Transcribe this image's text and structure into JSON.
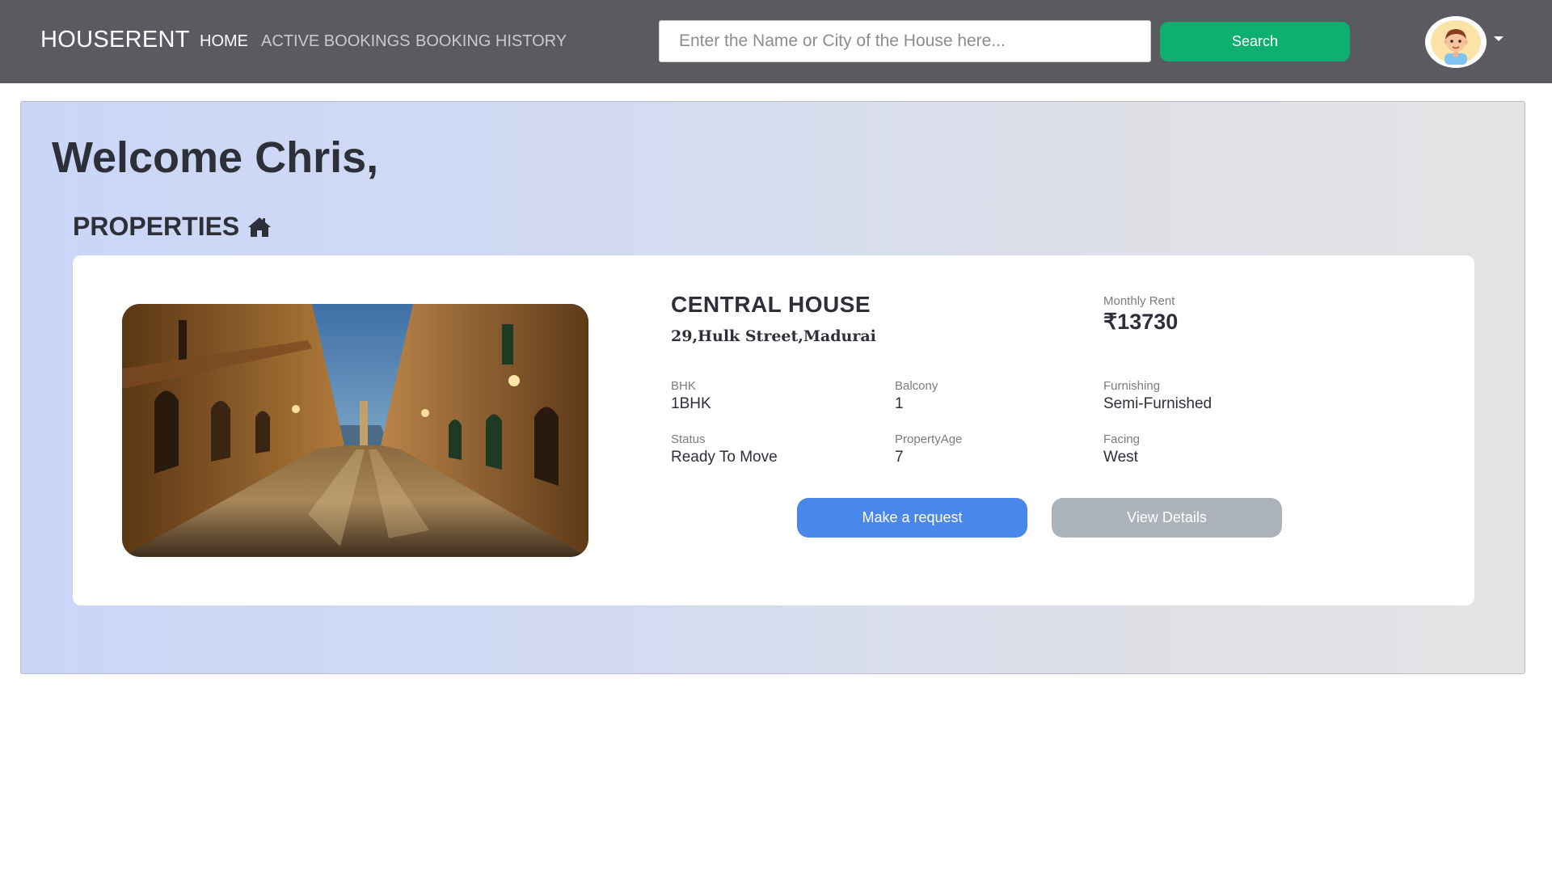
{
  "navbar": {
    "brand": "HOUSERENT",
    "links": [
      {
        "label": "HOME",
        "active": true
      },
      {
        "label": "ACTIVE BOOKINGS",
        "active": false
      },
      {
        "label": "BOOKING HISTORY",
        "active": false
      }
    ],
    "search": {
      "placeholder": "Enter the Name or City of the House here...",
      "value": "",
      "button_label": "Search"
    },
    "avatar_icon": "user-avatar-icon",
    "dropdown_icon": "caret-down-icon"
  },
  "main": {
    "welcome": "Welcome Chris,",
    "section_title": "PROPERTIES",
    "section_icon": "home-icon"
  },
  "property": {
    "name": "CENTRAL HOUSE",
    "address": "29,Hulk Street,Madurai",
    "rent_label": "Monthly Rent",
    "rent_value": "₹13730",
    "attributes": [
      {
        "label": "BHK",
        "value": "1BHK"
      },
      {
        "label": "Balcony",
        "value": "1"
      },
      {
        "label": "Furnishing",
        "value": "Semi-Furnished"
      },
      {
        "label": "Status",
        "value": "Ready To Move"
      },
      {
        "label": "PropertyAge",
        "value": "7"
      },
      {
        "label": "Facing",
        "value": "West"
      }
    ],
    "request_button": "Make a request",
    "details_button": "View Details"
  },
  "colors": {
    "navbar": "#5a5b61",
    "search_button": "#0fb06f",
    "request_button": "#4a87ea",
    "details_button": "#adb3ba"
  }
}
